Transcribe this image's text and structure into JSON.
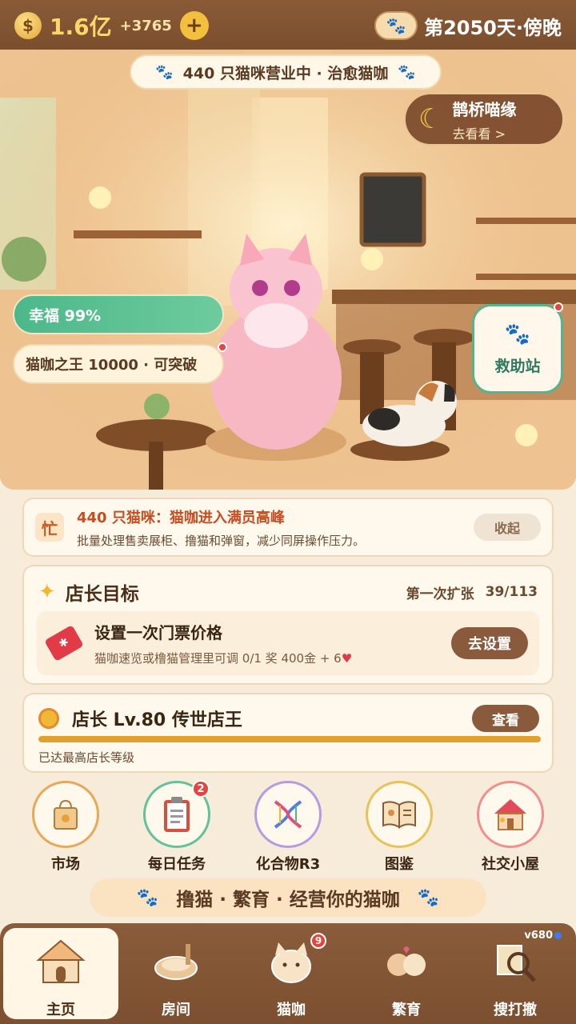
{
  "topbar": {
    "gold_icon": "money-bag-icon",
    "gold_amount": "1.6亿",
    "gold_delta": "+3765",
    "add_label": "+",
    "day_text": "第2050天·傍晚"
  },
  "hero": {
    "status": "440 只猫咪营业中 · 治愈猫咖",
    "event_title": "鹊桥喵缘",
    "event_sub": "去看看 >",
    "happiness": "幸福 99%",
    "king": "猫咖之王 10000 · 可突破",
    "rescue_label": "救助站"
  },
  "alert": {
    "icon_text": "忙",
    "title": "440 只猫咪：猫咖进入满员高峰",
    "desc": "批量处理售卖展柜、撸猫和弹窗，减少同屏操作压力。",
    "collapse_label": "收起"
  },
  "goal": {
    "title": "店长目标",
    "stage": "第一次扩张",
    "progress": "39/113",
    "task_title": "设置一次门票价格",
    "task_desc": "猫咖速览或橹猫管理里可调  0/1  奖 400金 + 6",
    "task_button": "去设置"
  },
  "level": {
    "title": "店长 Lv.80  传世店王",
    "view_label": "查看",
    "note": "已达最高店长等级",
    "progress": 1.0
  },
  "quick_actions": [
    {
      "label": "市场",
      "icon": "shopping-bag-icon",
      "ring": "#e8a85a"
    },
    {
      "label": "每日任务",
      "icon": "clipboard-icon",
      "ring": "#63c29a",
      "badge": "2"
    },
    {
      "label": "化合物R3",
      "icon": "dna-icon",
      "ring": "#b59be0"
    },
    {
      "label": "图鉴",
      "icon": "book-icon",
      "ring": "#e8c25a"
    },
    {
      "label": "社交小屋",
      "icon": "house-icon",
      "ring": "#ef8f8f"
    }
  ],
  "banner": {
    "text": "撸猫 · 繁育 · 经营你的猫咖"
  },
  "tabs": [
    {
      "label": "主页",
      "icon": "cat-house-icon",
      "active": true
    },
    {
      "label": "房间",
      "icon": "cat-bed-icon"
    },
    {
      "label": "猫咖",
      "icon": "cat-cup-icon",
      "badge": "9"
    },
    {
      "label": "繁育",
      "icon": "cat-couple-icon"
    },
    {
      "label": "搜打撤",
      "icon": "map-magnifier-icon"
    }
  ],
  "version": "v680",
  "colors": {
    "accent_brown": "#8a5a3c",
    "happy_green": "#4cb88a",
    "alert_red": "#c64d22",
    "gold": "#ffd66b"
  }
}
